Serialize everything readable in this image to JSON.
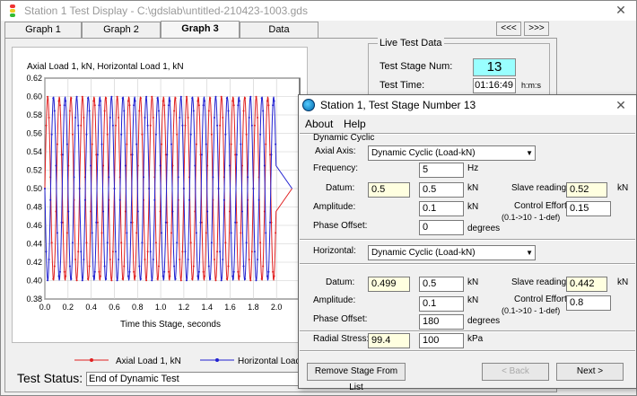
{
  "window": {
    "title": "Station 1 Test Display - C:\\gdslab\\untitled-210423-1003.gds"
  },
  "tabs": [
    {
      "label": "Graph 1"
    },
    {
      "label": "Graph 2"
    },
    {
      "label": "Graph 3"
    },
    {
      "label": "Data"
    }
  ],
  "nav": {
    "prev": "<<<",
    "next": ">>>"
  },
  "live": {
    "legend": "Live Test Data",
    "stage_label": "Test Stage Num:",
    "stage_value": "13",
    "time_label": "Test Time:",
    "time_value": "01:16:49",
    "time_unit": "h:m:s"
  },
  "status": {
    "label": "Test Status:",
    "value": "End of Dynamic Test"
  },
  "chart_data": {
    "type": "line",
    "title": "Axial Load 1, kN, Horizontal Load 1, kN",
    "xlabel": "Time this Stage, seconds",
    "xlim": [
      0,
      2.2
    ],
    "ylim": [
      0.38,
      0.62
    ],
    "xticks": [
      "0.0",
      "0.2",
      "0.4",
      "0.6",
      "0.8",
      "1.0",
      "1.2",
      "1.4",
      "1.6",
      "1.8",
      "2.0"
    ],
    "yticks": [
      "0.38",
      "0.40",
      "0.42",
      "0.44",
      "0.46",
      "0.48",
      "0.50",
      "0.52",
      "0.54",
      "0.56",
      "0.58",
      "0.60",
      "0.62"
    ],
    "frequency_hz": 10,
    "series": [
      {
        "name": "Axial Load 1, kN",
        "color": "#e02020",
        "mean": 0.5,
        "amplitude": 0.1,
        "phase_deg": 0,
        "end": 2.0
      },
      {
        "name": "Horizontal Load 1",
        "color": "#2020d0",
        "mean": 0.5,
        "amplitude": 0.1,
        "phase_deg": 180,
        "end": 2.0
      }
    ]
  },
  "dialog": {
    "title": "Station 1, Test Stage Number 13",
    "menu": {
      "about": "About",
      "help": "Help"
    },
    "group": "Dynamic Cyclic",
    "axial": {
      "axis_label": "Axial Axis:",
      "mode": "Dynamic Cyclic (Load-kN)",
      "frequency_label": "Frequency:",
      "frequency": "5",
      "frequency_unit": "Hz",
      "datum_label": "Datum:",
      "datum_current": "0.5",
      "datum": "0.5",
      "datum_unit": "kN",
      "slave_label": "Slave reading",
      "slave": "0.52",
      "slave_unit": "kN",
      "amplitude_label": "Amplitude:",
      "amplitude": "0.1",
      "amplitude_unit": "kN",
      "effort_label": "Control Effort",
      "effort_range": "(0.1->10 - 1-def)",
      "effort": "0.15",
      "phase_label": "Phase Offset:",
      "phase": "0",
      "phase_unit": "degrees"
    },
    "horizontal": {
      "axis_label": "Horizontal:",
      "mode": "Dynamic Cyclic (Load-kN)",
      "datum_label": "Datum:",
      "datum_current": "0.499",
      "datum": "0.5",
      "datum_unit": "kN",
      "slave_label": "Slave reading",
      "slave": "0.442",
      "slave_unit": "kN",
      "amplitude_label": "Amplitude:",
      "amplitude": "0.1",
      "amplitude_unit": "kN",
      "effort_label": "Control Effort",
      "effort_range": "(0.1->10 - 1-def)",
      "effort": "0.8",
      "phase_label": "Phase Offset:",
      "phase": "180",
      "phase_unit": "degrees"
    },
    "radial": {
      "label": "Radial Stress:",
      "current": "99.4",
      "value": "100",
      "unit": "kPa"
    },
    "buttons": {
      "remove": "Remove Stage From List",
      "back": "< Back",
      "next": "Next >"
    }
  }
}
